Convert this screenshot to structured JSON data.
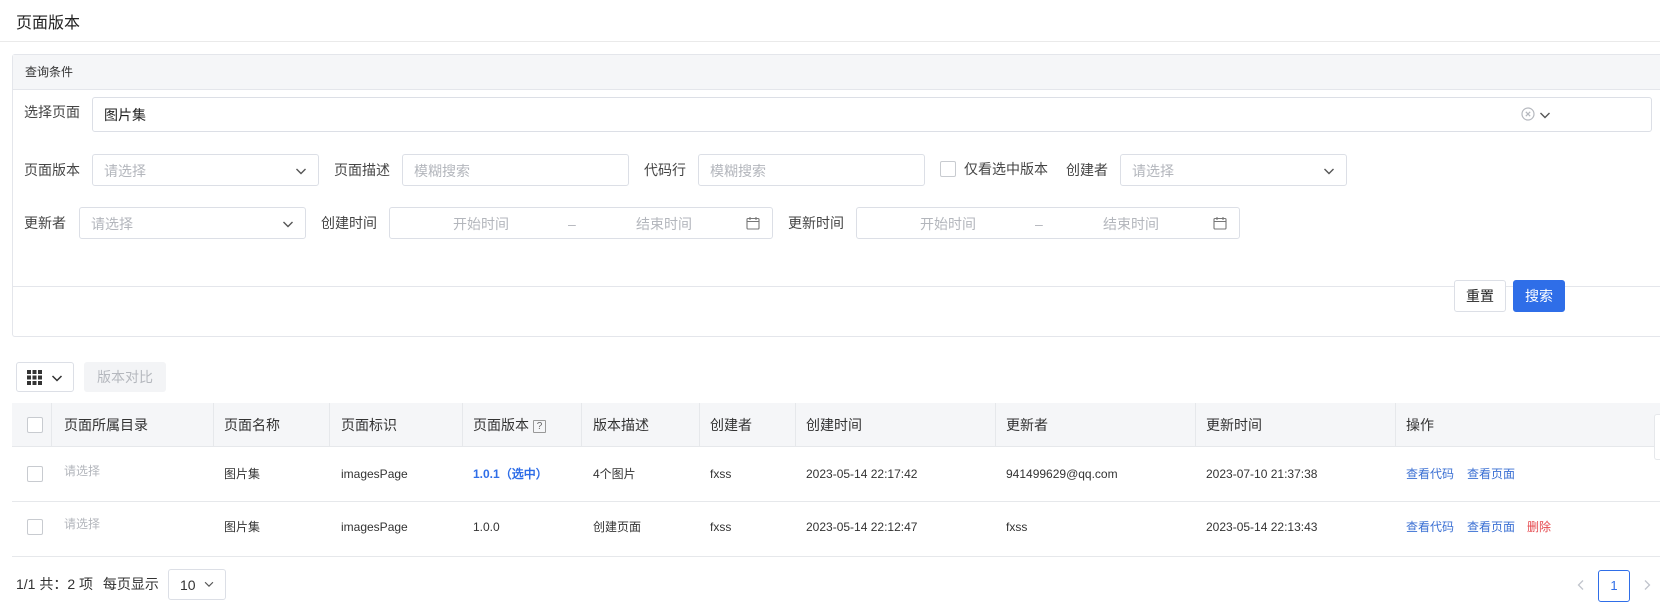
{
  "page": {
    "title": "页面版本"
  },
  "query": {
    "header": "查询条件",
    "select_page": {
      "label": "选择页面",
      "value": "图片集"
    },
    "page_version": {
      "label": "页面版本",
      "placeholder": "请选择"
    },
    "page_desc": {
      "label": "页面描述",
      "placeholder": "模糊搜索"
    },
    "code_line": {
      "label": "代码行",
      "placeholder": "模糊搜索"
    },
    "only_selected": {
      "label": "仅看选中版本"
    },
    "creator": {
      "label": "创建者",
      "placeholder": "请选择"
    },
    "updater": {
      "label": "更新者",
      "placeholder": "请选择"
    },
    "created_time": {
      "label": "创建时间",
      "start_placeholder": "开始时间",
      "separator": "–",
      "end_placeholder": "结束时间"
    },
    "updated_time": {
      "label": "更新时间",
      "start_placeholder": "开始时间",
      "separator": "–",
      "end_placeholder": "结束时间"
    },
    "reset_label": "重置",
    "search_label": "搜索"
  },
  "toolbar": {
    "compare_label": "版本对比"
  },
  "table": {
    "columns": [
      "页面所属目录",
      "页面名称",
      "页面标识",
      "页面版本",
      "版本描述",
      "创建者",
      "创建时间",
      "更新者",
      "更新时间",
      "操作"
    ],
    "help_mark": "?",
    "rows": [
      {
        "directory": "请选择",
        "name": "图片集",
        "identifier": "imagesPage",
        "version": "1.0.1（选中）",
        "description": "4个图片",
        "creator": "fxss",
        "created": "2023-05-14 22:17:42",
        "updater": "941499629@qq.com",
        "updated": "2023-07-10 21:37:38",
        "actions": [
          "查看代码",
          "查看页面"
        ]
      },
      {
        "directory": "请选择",
        "name": "图片集",
        "identifier": "imagesPage",
        "version": "1.0.0",
        "description": "创建页面",
        "creator": "fxss",
        "created": "2023-05-14 22:12:47",
        "updater": "fxss",
        "updated": "2023-05-14 22:13:43",
        "actions": [
          "查看代码",
          "查看页面",
          "删除"
        ]
      }
    ]
  },
  "pagination": {
    "summary": "1/1 共：2 项",
    "page_size_label": "每页显示",
    "page_size": "10",
    "current_page": "1"
  },
  "colors": {
    "primary": "#2f6ee8",
    "link": "#3a6fd3",
    "danger": "#e5484d",
    "placeholder": "#b3b6bc",
    "header_bg": "#f5f6f8"
  }
}
